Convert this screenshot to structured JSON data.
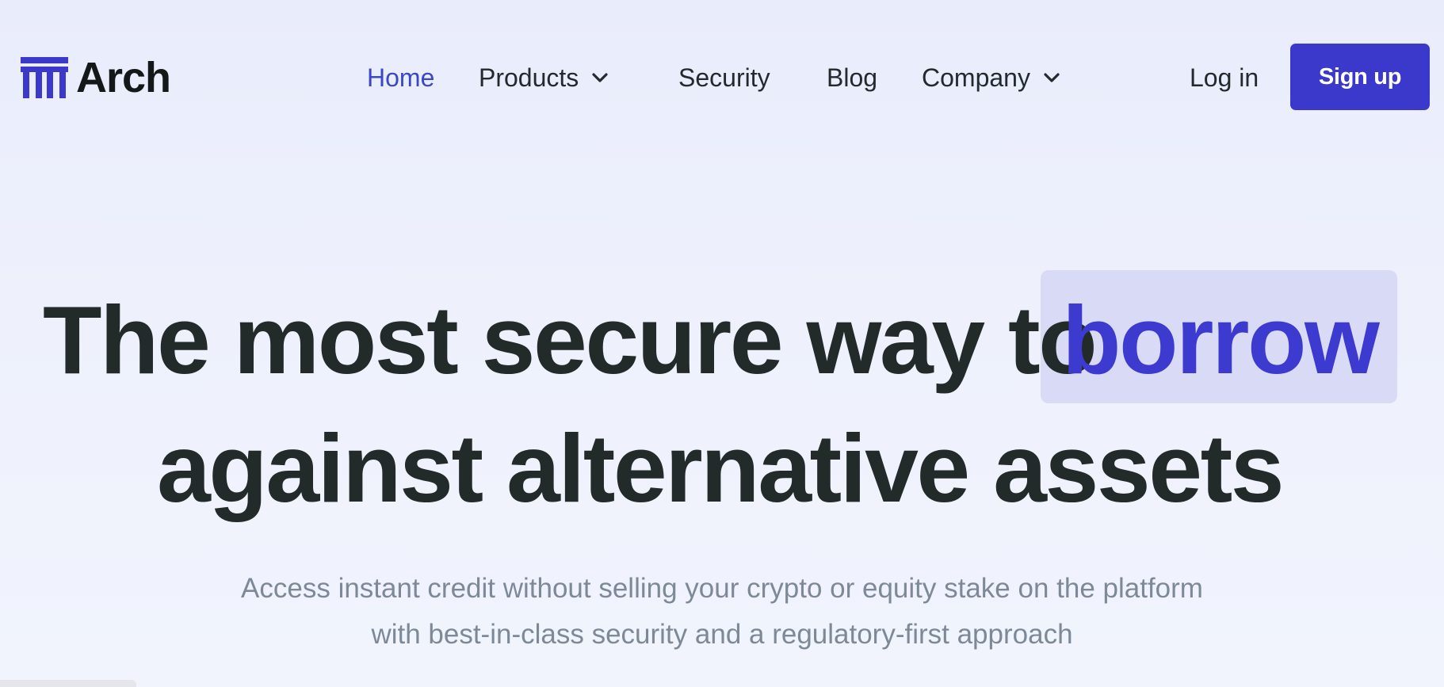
{
  "brand": {
    "name": "Arch",
    "logo_icon": "arch-columns-icon"
  },
  "nav": {
    "home": "Home",
    "products": "Products",
    "security": "Security",
    "blog": "Blog",
    "company": "Company",
    "active": "Home"
  },
  "auth": {
    "login": "Log in",
    "signup": "Sign up"
  },
  "hero": {
    "title_line1": "The most secure way to",
    "highlight": "borrow",
    "title_line2": "against alternative assets",
    "subtitle_line1": "Access instant credit without selling your crypto or equity stake on the platform",
    "subtitle_line2": "with best-in-class security and a regulatory-first approach"
  },
  "colors": {
    "accent": "#3b38cc",
    "highlight_bg": "#d9dbf6",
    "heading": "#222a2a",
    "muted": "#7e8998",
    "background": "#eef1fc"
  }
}
